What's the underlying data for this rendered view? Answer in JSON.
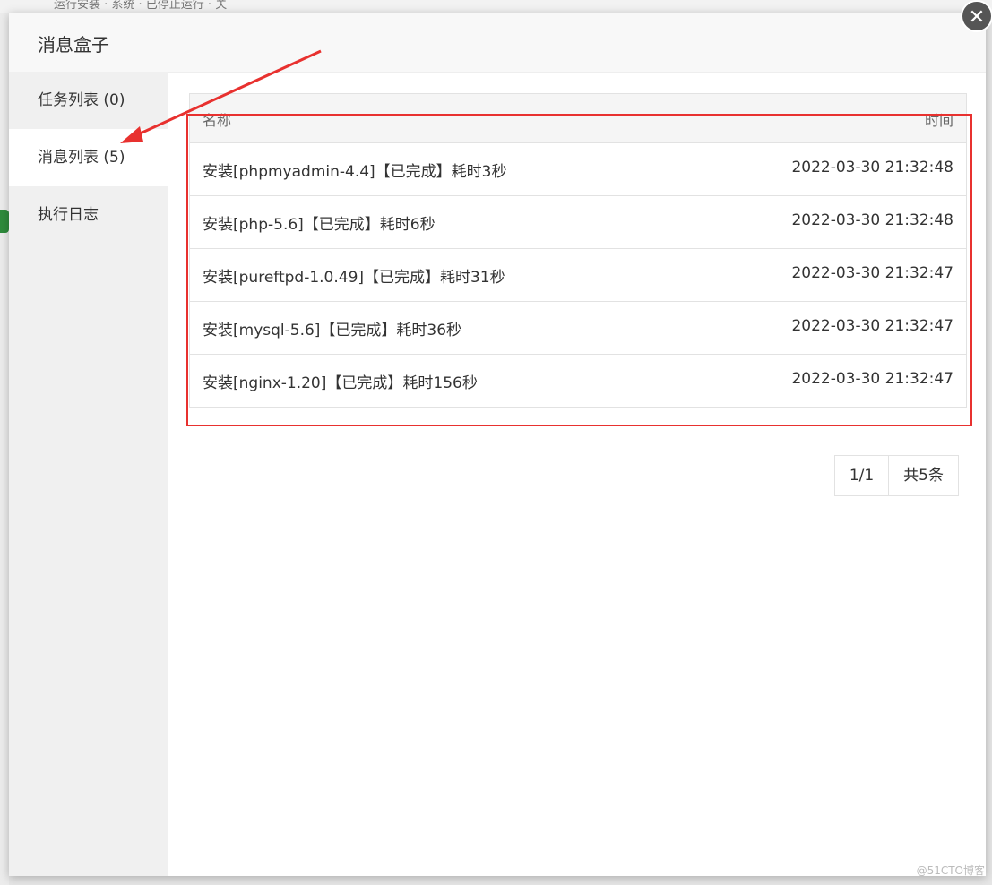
{
  "background": {
    "topbar_text": "运行安装 · 系统 · 已停止运行 · 关"
  },
  "modal": {
    "title": "消息盒子",
    "close_icon": "close-icon"
  },
  "sidebar": {
    "items": [
      {
        "label": "任务列表 (0)",
        "active": false
      },
      {
        "label": "消息列表 (5)",
        "active": true
      },
      {
        "label": "执行日志",
        "active": false
      }
    ]
  },
  "table": {
    "headers": {
      "name": "名称",
      "time": "时间"
    },
    "rows": [
      {
        "name": "安装[phpmyadmin-4.4]【已完成】耗时3秒",
        "time": "2022-03-30 21:32:48"
      },
      {
        "name": "安装[php-5.6]【已完成】耗时6秒",
        "time": "2022-03-30 21:32:48"
      },
      {
        "name": "安装[pureftpd-1.0.49]【已完成】耗时31秒",
        "time": "2022-03-30 21:32:47"
      },
      {
        "name": "安装[mysql-5.6]【已完成】耗时36秒",
        "time": "2022-03-30 21:32:47"
      },
      {
        "name": "安装[nginx-1.20]【已完成】耗时156秒",
        "time": "2022-03-30 21:32:47"
      }
    ]
  },
  "pager": {
    "page": "1/1",
    "total": "共5条"
  },
  "annotation": {
    "arrow_color": "#e8312f",
    "box_color": "#e8312f"
  },
  "watermark": "@51CTO博客"
}
